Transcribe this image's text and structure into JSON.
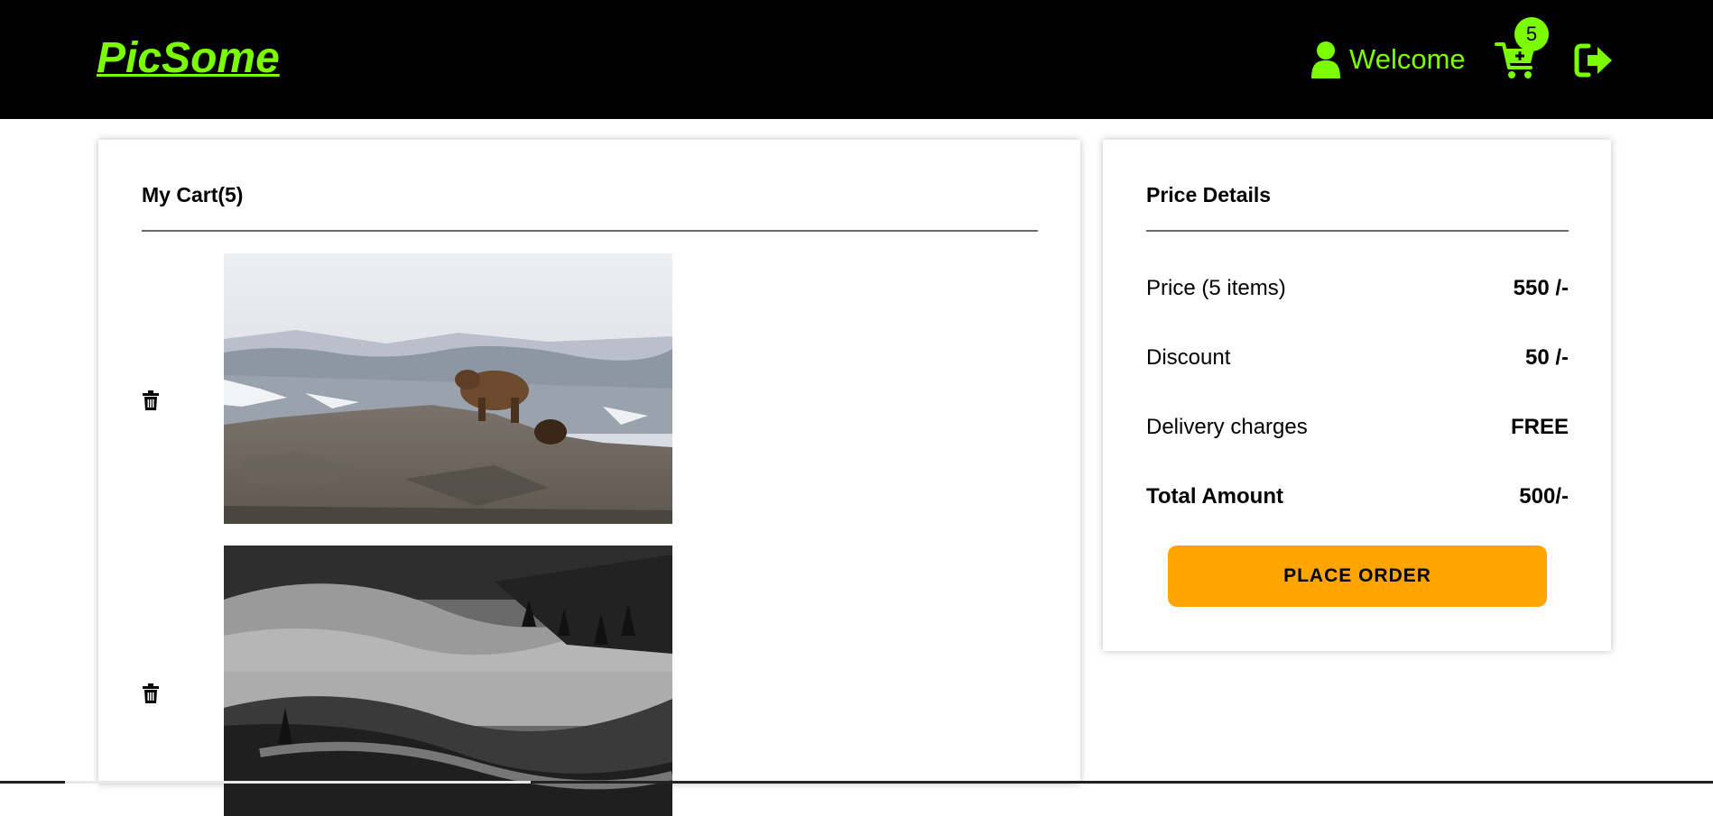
{
  "header": {
    "logo": "PicSome",
    "welcome_label": "Welcome",
    "cart_count": "5",
    "icons": [
      "user-icon",
      "cart-plus-icon",
      "logout-icon"
    ],
    "accent_color": "#7cfc00",
    "background_color": "#000000"
  },
  "cart": {
    "title": "My Cart(5)",
    "items": [
      {
        "image": "bear-on-rocky-hill-photo",
        "remove_icon": "trash-icon"
      },
      {
        "image": "misty-forest-bw-photo",
        "remove_icon": "trash-icon"
      }
    ]
  },
  "price_details": {
    "title": "Price Details",
    "rows": [
      {
        "label": "Price (5 items)",
        "value": "550 /-"
      },
      {
        "label": "Discount",
        "value": "50 /-"
      },
      {
        "label": "Delivery charges",
        "value": "FREE"
      },
      {
        "label": "Total Amount",
        "value": "500/-"
      }
    ],
    "place_order_label": "PLACE ORDER",
    "button_color": "#ffa500"
  }
}
